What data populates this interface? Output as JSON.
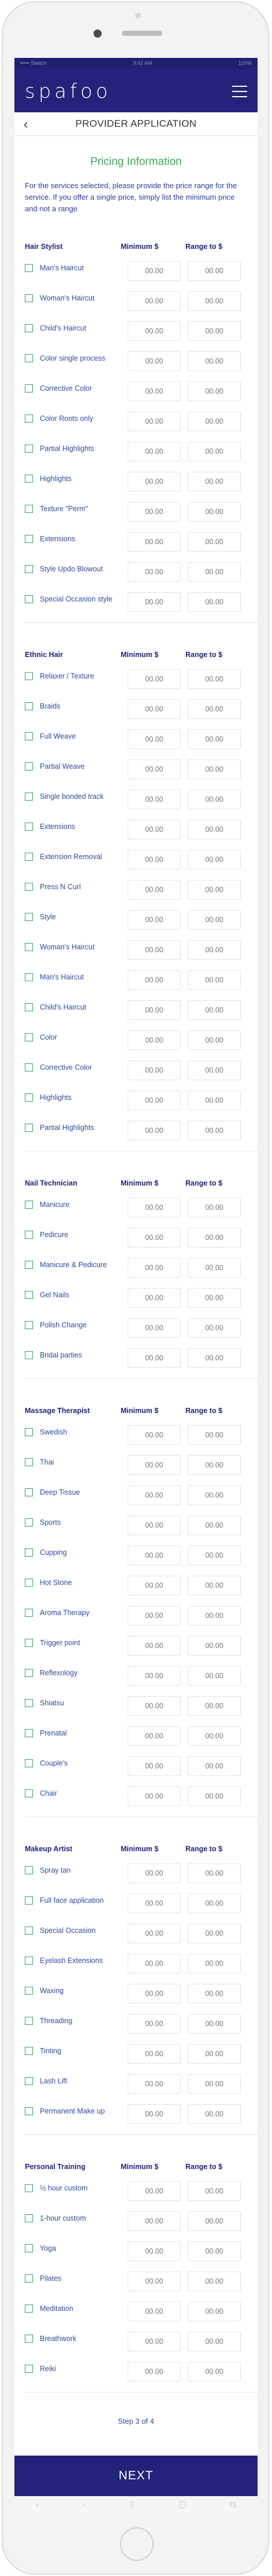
{
  "status_bar": {
    "carrier": "••••• Sketch",
    "time": "9:41 AM",
    "battery": "100%"
  },
  "brand": {
    "logo_text": "spafoo"
  },
  "header": {
    "menu_icon": "hamburger-icon"
  },
  "subheader": {
    "back_icon": "chevron-left-icon",
    "title": "PROVIDER APPLICATION"
  },
  "section_title": "Pricing Information",
  "intro": "For the services selected, please provide the price range for the service. If you offer a single price, simply list the minimum price and not a range",
  "columns": {
    "minimum": "Minimum $",
    "range": "Range to $"
  },
  "price_placeholder": "00.00",
  "groups": [
    {
      "name": "Hair Stylist",
      "services": [
        "Man's Haircut",
        "Woman's Haircut",
        "Child's Haircut",
        "Color single process",
        "Corrective Color",
        "Color Roots only",
        "Partial Highlights",
        "Highlights",
        "Texture \"Perm\"",
        "Extensions",
        "Style Updo Blowout",
        "Special Occasion style"
      ]
    },
    {
      "name": "Ethnic Hair",
      "services": [
        "Relaxer / Texture",
        "Braids",
        "Full Weave",
        "Partial Weave",
        "Single bonded track",
        "Extensions",
        "Extension Removal",
        "Press N Curl",
        "Style",
        "Woman's Haircut",
        "Man's Haircut",
        "Child's Haircut",
        "Color",
        "Corrective Color",
        "Highlights",
        "Partial Highlights"
      ]
    },
    {
      "name": "Nail Technician",
      "services": [
        "Manicure",
        "Pedicure",
        "Manicure & Pedicure",
        "Gel Nails",
        "Polish Change",
        "Bridal parties"
      ]
    },
    {
      "name": "Massage Therapist",
      "services": [
        "Swedish",
        "Thai",
        "Deep Tissue",
        "Sports",
        "Cupping",
        "Hot Stone",
        "Aroma Therapy",
        "Trigger point",
        "Reflexology",
        "Shiatsu",
        "Prenatal",
        "Couple's",
        "Chair"
      ]
    },
    {
      "name": "Makeup Artist",
      "services": [
        "Spray tan",
        "Full face application",
        "Special Occasion",
        "Eyelash Extensions",
        "Waxing",
        "Threading",
        "Tinting",
        "Lash Lift",
        "Permanent Make up"
      ]
    },
    {
      "name": "Personal Training",
      "services": [
        "½ hour custom",
        "1-hour custom",
        "Yoga",
        "Pilates",
        "Meditation",
        "Breathwork",
        "Reiki"
      ]
    }
  ],
  "step_text": "Step 3 of 4",
  "next_label": "NEXT",
  "browser_bar": {
    "icons": [
      "back-icon",
      "forward-icon",
      "share-icon",
      "bookmarks-icon",
      "tabs-icon"
    ],
    "glyphs": [
      "‹",
      "›",
      "⇧",
      "▢",
      "⧉"
    ]
  }
}
